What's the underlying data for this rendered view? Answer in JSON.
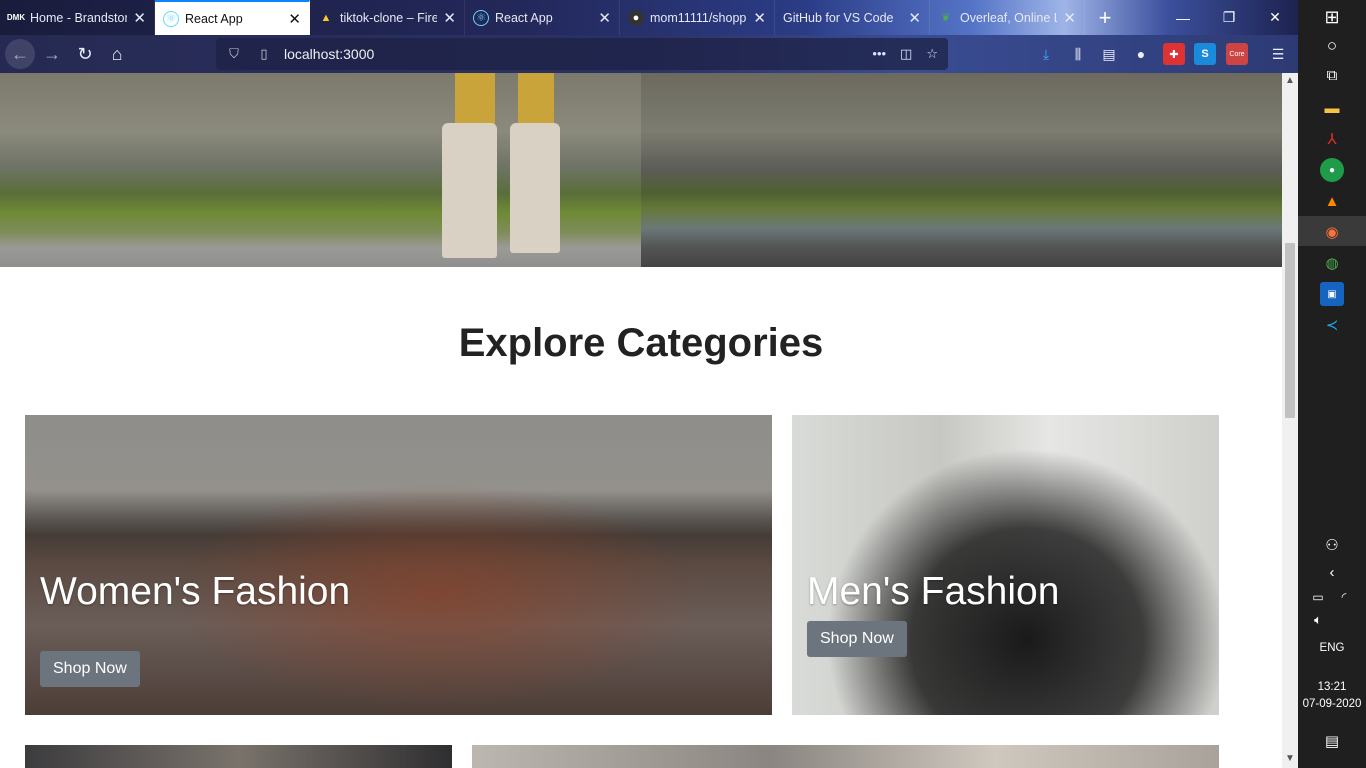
{
  "browser": {
    "tabs": [
      {
        "title": "Home - Brandstore",
        "favicon": "dmk-icon",
        "active": false
      },
      {
        "title": "React App",
        "favicon": "react-icon",
        "active": true
      },
      {
        "title": "tiktok-clone – Fire",
        "favicon": "firebase-icon",
        "active": false
      },
      {
        "title": "React App",
        "favicon": "react-icon",
        "active": false
      },
      {
        "title": "mom11111/shopp",
        "favicon": "github-icon",
        "active": false
      },
      {
        "title": "GitHub for VS Code",
        "favicon": "",
        "active": false
      },
      {
        "title": "Overleaf, Online L",
        "favicon": "overleaf-icon",
        "active": false
      }
    ],
    "new_tab_label": "+",
    "url": "localhost:3000",
    "colors": {
      "accent": "#0a84ff",
      "tabbar": "#23285a"
    }
  },
  "page": {
    "section_title": "Explore Categories",
    "categories": [
      {
        "title": "Women's Fashion",
        "button": "Shop Now"
      },
      {
        "title": "Men's Fashion",
        "button": "Shop Now"
      }
    ],
    "button_color": "#6c757d"
  },
  "taskbar": {
    "language": "ENG",
    "time": "13:21",
    "date": "07-09-2020"
  }
}
